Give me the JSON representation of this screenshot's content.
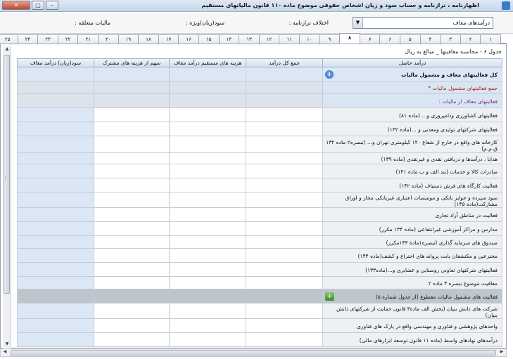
{
  "window": {
    "title": "اظهارنامه ، ترازنامه و حساب سود و زیان اشخاص حقوقی موضوع ماده ۱۱۰ قانون مالیاتهای مستقیم",
    "close_label": "✕",
    "max_label": "▢",
    "min_label": "–"
  },
  "top": {
    "combo_value": "درآمدهای معاف",
    "combo_arrow": "▼",
    "field_1": "اختلاف ترازنامه :",
    "field_2": "سود(زیان)ویژه :",
    "field_3": "مالیات متعلقه :"
  },
  "tabs": [
    "۱",
    "۲",
    "۳",
    "۴",
    "۵",
    "۶",
    "۷",
    "۸",
    "۹",
    "۱۰",
    "۱۱",
    "۱۲",
    "۱۳",
    "۱۴",
    "۱۵",
    "۱۶",
    "۱۷",
    "۱۸",
    "۱۹",
    "۲۰",
    "۲۱",
    "۲۲",
    "۲۳",
    "۲۴",
    "۲۵"
  ],
  "active_tab": "۸",
  "caption": "جدول ۶ - محاسبه معافیتها _ مبالغ به ریال",
  "columns": {
    "c0": "درآمد حاصل",
    "c1": "جمع کل درآمد",
    "c2": "هزینه های مستقیم درآمد معاف",
    "c3": "سهم از هزینه های مشترک",
    "c4": "سود(زیان) درآمد معاف"
  },
  "rows": [
    {
      "label": "کل فعالیتهای معاف و مشمول مالیات",
      "style": "total",
      "icon": "info"
    },
    {
      "label": "جمع فعالیتهای مشمول مالیات *",
      "style": "red"
    },
    {
      "label": "فعالیتهای معاف از مالیات :",
      "style": "purple"
    },
    {
      "label": "فعالیتهای کشاورزی ودامپروری و... (ماده ۸۱)"
    },
    {
      "label": "فعالیتهای شرکتهای تولیدی ومعدنی و ...(ماده ۱۳۲)"
    },
    {
      "label": "کارخانه های واقع در خارج از شعاع ۱۲۰ کیلومتری تهران و... (تبصره۲ ماده ۱۳۲ ق.م.م)"
    },
    {
      "label": "هدایا ، درآمدها و دریافتی نقدی و غیرنقدی (ماده ۱۳۹)"
    },
    {
      "label": "صادرات کالا و خدمات (بند الف و ب ماده ۱۴۱)"
    },
    {
      "label": "فعالیت کارگاه های فرش دستباف (ماده ۱۴۲)"
    },
    {
      "label": "سود سپرده و جوایز بانکی و موسسات اعتباری غیربانکی مجاز و اوراق مشارکت(ماده ۱۴۵)"
    },
    {
      "label": "فعالیت در مناطق آزاد تجاری"
    },
    {
      "label": "مدارس و مراکز آموزشی غیرانتفاعی (ماده ۱۳۴ مکرر)"
    },
    {
      "label": "صندوق های سرمایه گذاری (تبصره۱ماده ۱۴۳مکرر)"
    },
    {
      "label": "مخترعین و مکتشفان بابت پروانه های اختراع و کشف(ماده ۱۴۴)"
    },
    {
      "label": "فعالیتهای شرکتهای تعاونی روستایی و عشایری و...(ماده۱۳۳)"
    },
    {
      "label": "معافیت موضوع تبصره ۳ ماده ۲"
    },
    {
      "label": "فعالیت های مشمول مالیات مقطوع (از جدول شماره ۵)",
      "style": "grey",
      "icon": "add"
    },
    {
      "label": "شرکت های دانش بنیان (بخش الف ماده۳ قانون حمایت از شرکتهای دانش بنیان)"
    },
    {
      "label": "واحدهای پژوهشی و فناوری و مهندسی واقع در پارک های فناوری"
    },
    {
      "label": "درآمدهای نهادهای واسط (ماده ۱۱ قانون توسعه ابزارهای مالی)"
    }
  ]
}
